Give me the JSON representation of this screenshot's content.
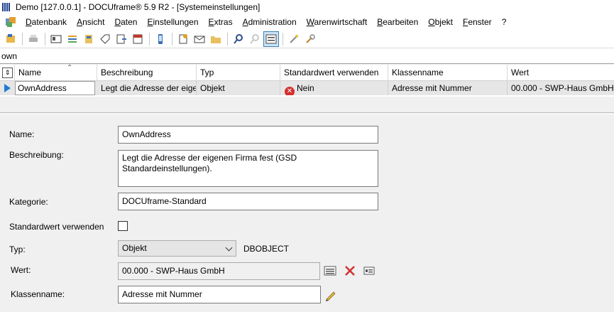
{
  "window": {
    "title": "Demo [127.0.0.1] - DOCUframe® 5.9 R2 - [Systemeinstellungen]"
  },
  "menu": [
    "Datenbank",
    "Ansicht",
    "Daten",
    "Einstellungen",
    "Extras",
    "Administration",
    "Warenwirtschaft",
    "Bearbeiten",
    "Objekt",
    "Fenster",
    "?"
  ],
  "toolbar": {
    "icons": [
      "new-record-icon",
      "print-icon",
      "card-icon",
      "list-icon",
      "archive-icon",
      "tag-icon",
      "export-icon",
      "calendar-icon",
      "phone-icon",
      "new-document-icon",
      "mail-icon",
      "folder-icon",
      "search-icon",
      "search-disabled-icon",
      "form-view-icon",
      "wand-icon",
      "tools-icon"
    ]
  },
  "filter": {
    "value": "own"
  },
  "grid": {
    "columns": [
      "Name",
      "Beschreibung",
      "Typ",
      "Standardwert verwenden",
      "Klassenname",
      "Wert"
    ],
    "row": {
      "name": "OwnAddress",
      "beschreibung": "Legt die Adresse der eigenen Firma fest (GSD Standardeinstellungen).",
      "typ": "Objekt",
      "standardwert": "Nein",
      "klassenname": "Adresse mit Nummer",
      "wert": "00.000 - SWP-Haus GmbH"
    }
  },
  "form": {
    "name_label": "Name:",
    "name_value": "OwnAddress",
    "beschreibung_label": "Beschreibung:",
    "beschreibung_value": "Legt die Adresse der eigenen Firma fest (GSD Standardeinstellungen).",
    "kategorie_label": "Kategorie:",
    "kategorie_value": "DOCUframe-Standard",
    "standardwert_label": "Standardwert verwenden",
    "standardwert_checked": false,
    "typ_label": "Typ:",
    "typ_value": "Objekt",
    "typ_class": "DBOBJECT",
    "wert_label": "Wert:",
    "wert_value": "00.000 - SWP-Haus GmbH",
    "klassenname_label": "Klassenname:",
    "klassenname_value": "Adresse mit Nummer"
  }
}
